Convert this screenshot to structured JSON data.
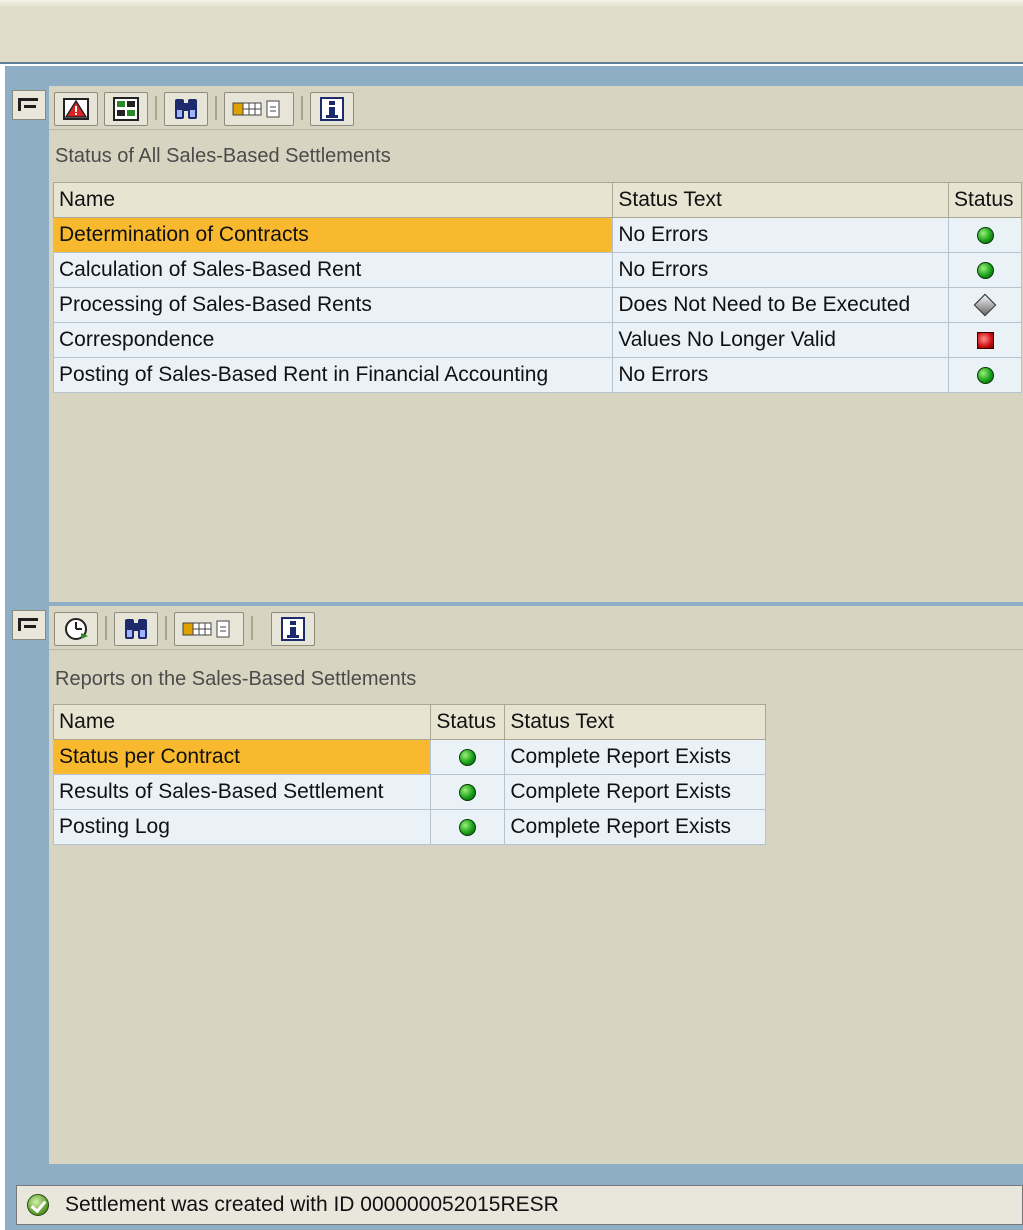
{
  "panel_one": {
    "title": "Status of All Sales-Based Settlements",
    "toolbar_icons": [
      "alert-icon",
      "overview-icon",
      "find-icon",
      "layout-icon",
      "info-icon"
    ],
    "columns": [
      "Name",
      "Status Text",
      "Status"
    ],
    "rows": [
      {
        "name": "Determination of Contracts",
        "status_text": "No Errors",
        "status_icon": "green-light-icon",
        "selected": true
      },
      {
        "name": "Calculation of Sales-Based Rent",
        "status_text": "No Errors",
        "status_icon": "green-light-icon",
        "selected": false
      },
      {
        "name": "Processing of Sales-Based Rents",
        "status_text": "Does Not Need to Be Executed",
        "status_icon": "gray-diamond-icon",
        "selected": false
      },
      {
        "name": "Correspondence",
        "status_text": "Values No Longer Valid",
        "status_icon": "red-square-icon",
        "selected": false
      },
      {
        "name": "Posting of Sales-Based Rent in Financial Accounting",
        "status_text": "No Errors",
        "status_icon": "green-light-icon",
        "selected": false
      }
    ]
  },
  "panel_two": {
    "title": "Reports on the Sales-Based Settlements",
    "toolbar_icons": [
      "clock-icon",
      "find-icon",
      "layout-icon",
      "info-icon"
    ],
    "columns": [
      "Name",
      "Status",
      "Status Text"
    ],
    "rows": [
      {
        "name": "Status per Contract",
        "status_icon": "green-light-icon",
        "status_text": "Complete Report Exists",
        "selected": true
      },
      {
        "name": "Results of Sales-Based Settlement",
        "status_icon": "green-light-icon",
        "status_text": "Complete Report Exists",
        "selected": false
      },
      {
        "name": "Posting Log",
        "status_icon": "green-light-icon",
        "status_text": "Complete Report Exists",
        "selected": false
      }
    ]
  },
  "status_bar": {
    "icon": "success-check-icon",
    "message": "Settlement was created with ID 000000052015RESR"
  },
  "colors": {
    "frame_blue": "#8eaec6",
    "panel_gray": "#d7d4c1",
    "selected_row": "#f8b92e",
    "cell_bg": "#eaf2f8"
  }
}
